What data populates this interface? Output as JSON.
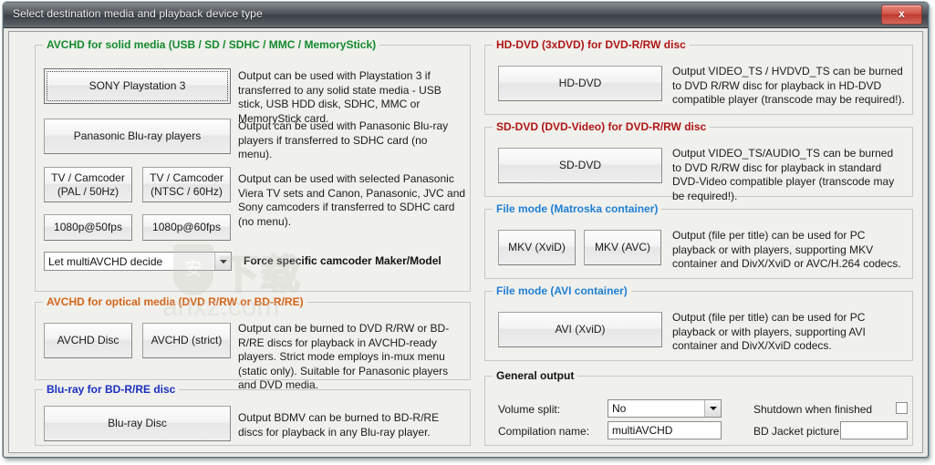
{
  "window": {
    "title": "Select destination media and playback device type",
    "close_label": "x"
  },
  "colors": {
    "green": "#138a2e",
    "orange": "#d4651a",
    "blue_dark": "#1a2fc0",
    "red_dark": "#b01515",
    "blue": "#1f7fd4",
    "black": "#111111"
  },
  "groups": {
    "avchd_solid": {
      "legend": "AVCHD for solid media (USB / SD / SDHC / MMC / MemoryStick)",
      "buttons": {
        "ps3": "SONY Playstation 3",
        "panasonic_bluray": "Panasonic Blu-ray players",
        "tv_pal": "TV / Camcoder\n(PAL / 50Hz)",
        "tv_ntsc": "TV / Camcoder\n(NTSC / 60Hz)",
        "p50": "1080p@50fps",
        "p60": "1080p@60fps"
      },
      "descriptions": {
        "ps3": "Output can be used with Playstation 3 if transferred to any solid state media - USB stick, USB HDD disk, SDHC, MMC or MemoryStick card.",
        "panasonic_bluray": "Output can be used with Panasonic Blu-ray players if transferred to SDHC card (no menu).",
        "tv_camcoder": "Output can be used with selected Panasonic Viera TV sets and Canon, Panasonic, JVC and Sony camcoders if transferred to SDHC card (no menu)."
      },
      "combo_value": "Let multiAVCHD decide",
      "combo_label": "Force specific camcoder Maker/Model"
    },
    "avchd_optical": {
      "legend": "AVCHD for optical media (DVD R/RW or BD-R/RE)",
      "buttons": {
        "avchd_disc": "AVCHD Disc",
        "avchd_strict": "AVCHD (strict)"
      },
      "description": "Output can be burned to DVD R/RW or BD-R/RE discs for playback in AVCHD-ready players. Strict mode employs in-mux menu (static only). Suitable for Panasonic players and DVD media."
    },
    "bluray": {
      "legend": "Blu-ray for BD-R/RE disc",
      "buttons": {
        "bluray_disc": "Blu-ray Disc"
      },
      "description": "Output BDMV can be burned to BD-R/RE discs for playback in any Blu-ray player."
    },
    "hd_dvd": {
      "legend": "HD-DVD (3xDVD) for DVD-R/RW disc",
      "buttons": {
        "hd_dvd": "HD-DVD"
      },
      "description": "Output VIDEO_TS / HVDVD_TS can be burned to DVD R/RW disc for playback in HD-DVD compatible player (transcode may be required!)."
    },
    "sd_dvd": {
      "legend": "SD-DVD (DVD-Video) for DVD-R/RW disc",
      "buttons": {
        "sd_dvd": "SD-DVD"
      },
      "description": "Output VIDEO_TS/AUDIO_TS can be burned to DVD R/RW disc for playback in standard DVD-Video compatible player (transcode may be required!)."
    },
    "file_mkv": {
      "legend": "File mode (Matroska container)",
      "buttons": {
        "mkv_xvid": "MKV (XviD)",
        "mkv_avc": "MKV (AVC)"
      },
      "description": "Output (file per title) can be used for PC playback or with players, supporting MKV container and DivX/XviD or AVC/H.264 codecs."
    },
    "file_avi": {
      "legend": "File mode (AVI container)",
      "buttons": {
        "avi_xvid": "AVI (XviD)"
      },
      "description": "Output (file per title) can be used for PC playback or with players, supporting AVI container and DivX/XviD codecs."
    },
    "general_output": {
      "legend": "General output",
      "volume_split_label": "Volume split:",
      "volume_split_value": "No",
      "compilation_name_label": "Compilation name:",
      "compilation_name_value": "multiAVCHD",
      "shutdown_label": "Shutdown when finished",
      "shutdown_checked": false,
      "bd_jacket_label": "BD Jacket picture:",
      "bd_jacket_value": ""
    }
  },
  "watermark": {
    "cn": "下载",
    "en": "anxz.com",
    "shield_glyph": "安"
  }
}
